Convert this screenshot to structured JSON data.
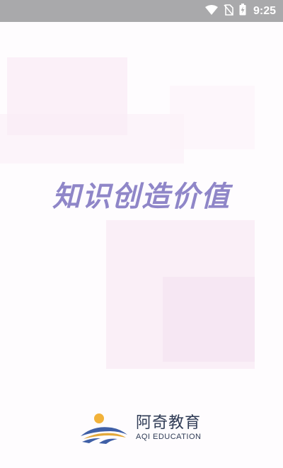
{
  "status_bar": {
    "time": "9:25",
    "icons": [
      "wifi-icon",
      "no-sim-icon",
      "battery-charging-icon"
    ],
    "background_color": "#a9a9ab"
  },
  "splash": {
    "slogan": "知识创造价值",
    "slogan_color": "#8f86c8"
  },
  "brand": {
    "name": "阿奇教育",
    "subtitle": "AQI EDUCATION",
    "logo_icon": "aqi-education-logo-icon",
    "colors": {
      "sun": "#f2b23a",
      "arc_blue": "#3f5fa6",
      "arc_gold": "#e3a93b",
      "text": "#2f3b55"
    }
  }
}
